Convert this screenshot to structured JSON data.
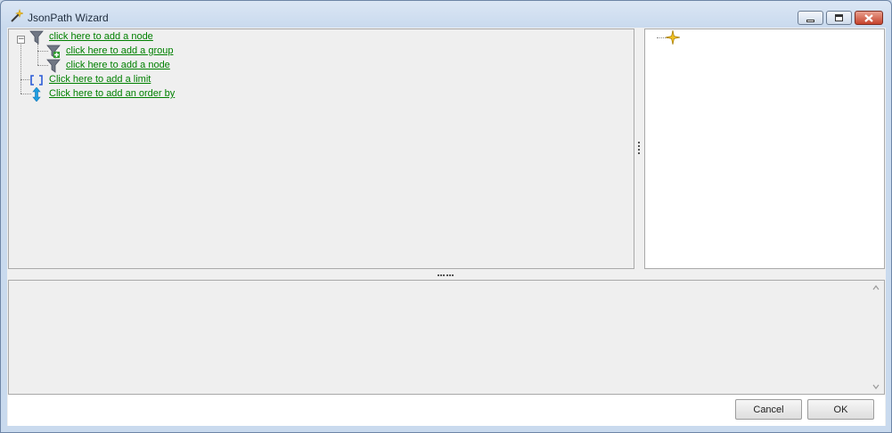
{
  "window": {
    "title": "JsonPath Wizard",
    "controls": [
      "minimize",
      "maximize",
      "close"
    ]
  },
  "tree": {
    "root": {
      "label": "click here to add a node",
      "icon": "filter-icon",
      "expander": "−"
    },
    "children": [
      {
        "label": "click here to add a group",
        "icon": "filter-add-group-icon"
      },
      {
        "label": "click here to add a node",
        "icon": "filter-icon"
      }
    ],
    "limit": {
      "label": "Click here to add a limit",
      "icon": "brackets-icon"
    },
    "order_by": {
      "label": "Click here to add an order by",
      "icon": "sort-arrows-icon"
    }
  },
  "preview_tree": {
    "node_icon": "star-node-icon"
  },
  "footer": {
    "cancel_label": "Cancel",
    "ok_label": "OK"
  },
  "colors": {
    "link": "#008000",
    "accent_icon": "#f0c020",
    "filter_icon": "#707784"
  }
}
